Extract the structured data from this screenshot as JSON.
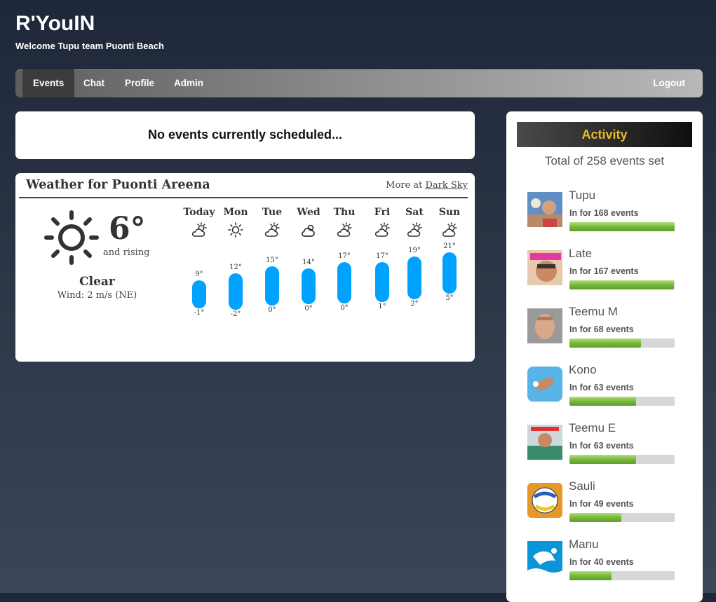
{
  "app": {
    "title": "R'YouIN",
    "subtitle": "Welcome Tupu team Puonti Beach"
  },
  "nav": {
    "events": "Events",
    "chat": "Chat",
    "profile": "Profile",
    "admin": "Admin",
    "logout": "Logout",
    "active": "Events"
  },
  "events": {
    "message": "No events currently scheduled..."
  },
  "weather": {
    "title": "Weather for Puonti Areena",
    "more_prefix": "More at",
    "more_link": "Dark Sky",
    "current": {
      "icon": "sun-icon",
      "temp": "6°",
      "trend": "and rising",
      "summary": "Clear",
      "wind": "Wind: 2 m/s (NE)"
    },
    "days": [
      {
        "name": "Today",
        "icon": "partly-cloudy-icon",
        "high": "9°",
        "low": "-1°"
      },
      {
        "name": "Mon",
        "icon": "sun-icon",
        "high": "12°",
        "low": "-2°"
      },
      {
        "name": "Tue",
        "icon": "partly-cloudy-icon",
        "high": "15°",
        "low": "0°"
      },
      {
        "name": "Wed",
        "icon": "cloud-icon",
        "high": "14°",
        "low": "0°"
      },
      {
        "name": "Thu",
        "icon": "partly-cloudy-icon",
        "high": "17°",
        "low": "0°"
      },
      {
        "name": "Fri",
        "icon": "partly-cloudy-icon",
        "high": "17°",
        "low": "1°"
      },
      {
        "name": "Sat",
        "icon": "partly-cloudy-icon",
        "high": "19°",
        "low": "2°"
      },
      {
        "name": "Sun",
        "icon": "partly-cloudy-icon",
        "high": "21°",
        "low": "5°"
      }
    ],
    "bar_color": "#00a2ff"
  },
  "activity": {
    "title": "Activity",
    "total": "Total of 258 events set",
    "title_color": "#e8b82a",
    "users": [
      {
        "name": "Tupu",
        "count_text": "In for 168 events",
        "count": 168,
        "progress": 1.0,
        "avatar": "avatar-tupu"
      },
      {
        "name": "Late",
        "count_text": "In for 167 events",
        "count": 167,
        "progress": 0.99,
        "avatar": "avatar-late"
      },
      {
        "name": "Teemu M",
        "count_text": "In for 68 events",
        "count": 68,
        "progress": 0.68,
        "avatar": "avatar-teemu-m"
      },
      {
        "name": "Kono",
        "count_text": "In for 63 events",
        "count": 63,
        "progress": 0.63,
        "avatar": "avatar-kono"
      },
      {
        "name": "Teemu E",
        "count_text": "In for 63 events",
        "count": 63,
        "progress": 0.63,
        "avatar": "avatar-teemu-e"
      },
      {
        "name": "Sauli",
        "count_text": "In for 49 events",
        "count": 49,
        "progress": 0.49,
        "avatar": "avatar-sauli"
      },
      {
        "name": "Manu",
        "count_text": "In for 40 events",
        "count": 40,
        "progress": 0.4,
        "avatar": "avatar-manu"
      }
    ]
  }
}
